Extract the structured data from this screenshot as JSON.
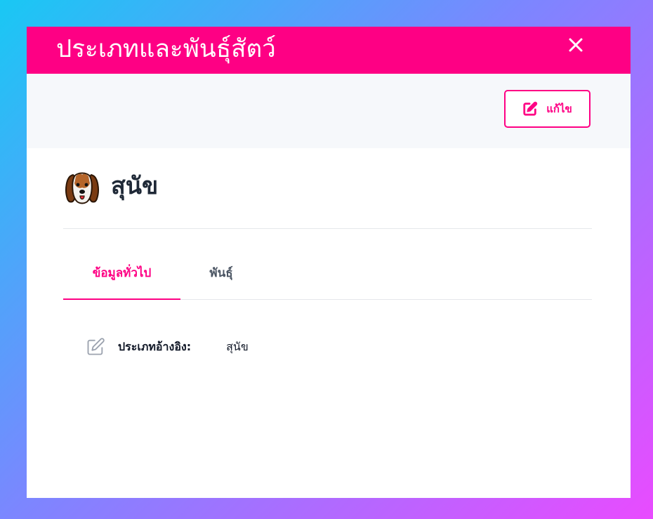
{
  "modal": {
    "title": "ประเภทและพันธุ์สัตว์",
    "close_icon": "close-icon"
  },
  "toolbar": {
    "edit_label": "แก้ไข",
    "edit_icon": "edit-icon"
  },
  "species": {
    "icon": "dog-icon",
    "name": "สุนัข"
  },
  "tabs": [
    {
      "label": "ข้อมูลทั่วไป",
      "active": true
    },
    {
      "label": "พันธุ์",
      "active": false
    }
  ],
  "details": {
    "icon": "pencil-icon",
    "label": "ประเภทอ้างอิง:",
    "value": "สุนัข"
  },
  "colors": {
    "accent": "#fe0084",
    "toolbar_bg": "#f6f8fb",
    "text_dark": "#1f2937"
  }
}
